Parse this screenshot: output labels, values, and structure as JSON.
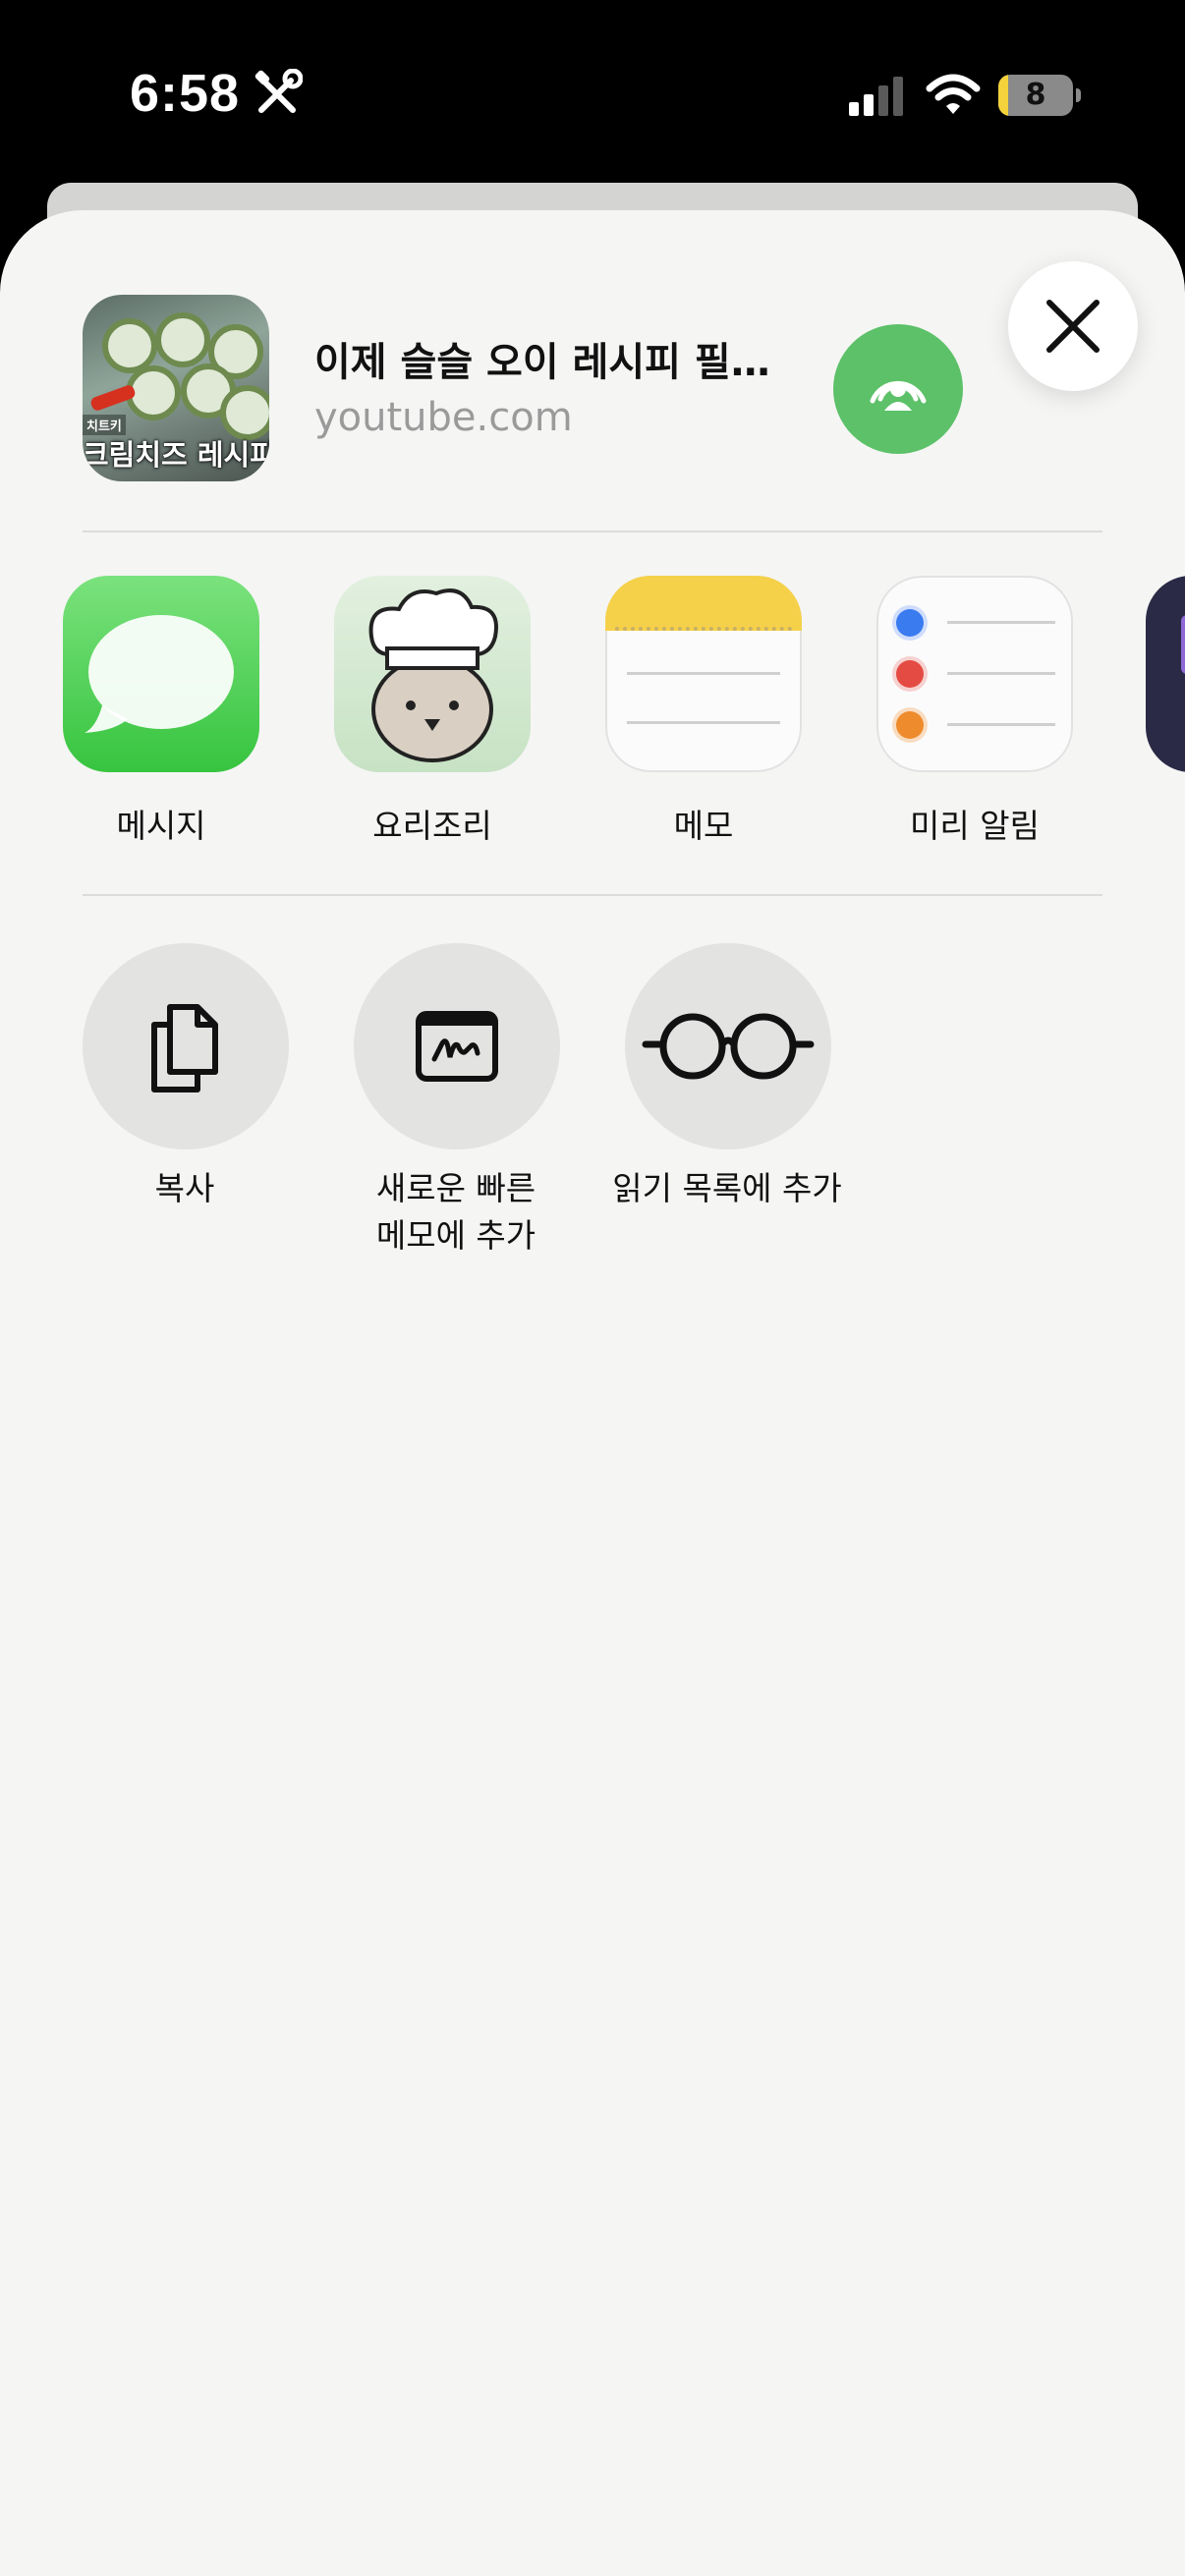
{
  "status_bar": {
    "time": "6:58",
    "battery_level": "8",
    "battery_fraction": 0.08
  },
  "share_header": {
    "thumbnail_caption": "크림치즈 레시피",
    "thumbnail_tag": "치트키",
    "title": "이제 슬슬 오이 레시피 필…",
    "subtitle": "youtube.com",
    "airdrop_color": "#5cc168"
  },
  "apps": [
    {
      "label": "메시지",
      "icon": "messages-icon"
    },
    {
      "label": "요리조리",
      "icon": "chef-bear-icon"
    },
    {
      "label": "메모",
      "icon": "notes-icon"
    },
    {
      "label": "미리 알림",
      "icon": "reminders-icon"
    }
  ],
  "actions": [
    {
      "label": "복사",
      "icon": "copy-icon"
    },
    {
      "label": "새로운 빠른\n메모에 추가",
      "label_line1": "새로운 빠른",
      "label_line2": "메모에 추가",
      "icon": "quick-note-icon"
    },
    {
      "label": "읽기 목록에 추가",
      "icon": "glasses-icon"
    }
  ]
}
